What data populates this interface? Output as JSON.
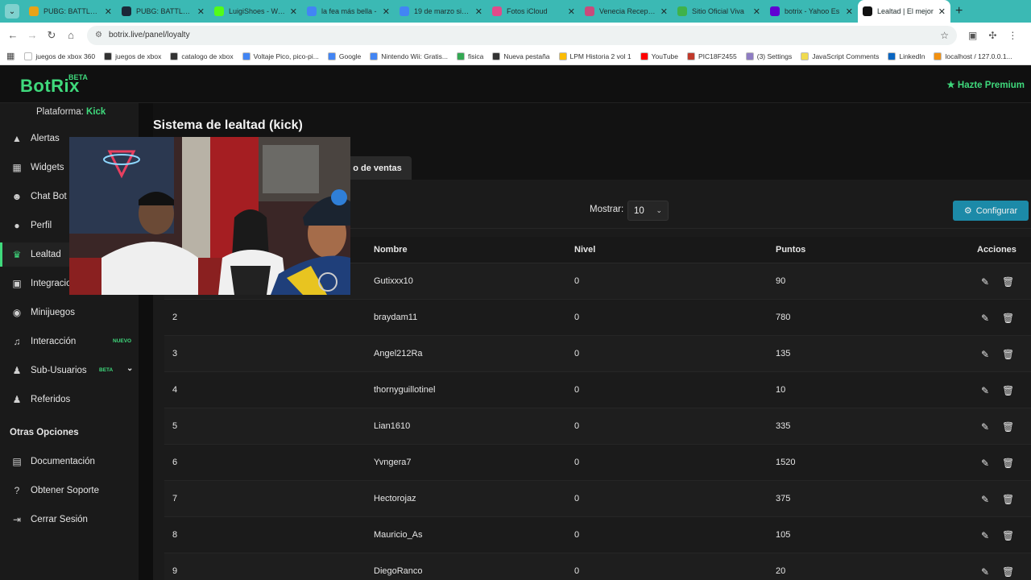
{
  "browser": {
    "tabs": [
      {
        "label": "PUBG: BATTLEGROUNDS",
        "color": "#e8a317"
      },
      {
        "label": "PUBG: BATTLEGROUNDS",
        "color": "#1b2838"
      },
      {
        "label": "LuigiShoes - Watch",
        "color": "#53fc18"
      },
      {
        "label": "la fea más bella -",
        "color": "#4285f4"
      },
      {
        "label": "19 de marzo signo",
        "color": "#4285f4"
      },
      {
        "label": "Fotos iCloud",
        "color": "#e04b8a"
      },
      {
        "label": "Venecia Recepción",
        "color": "#c94b7b"
      },
      {
        "label": "Sitio Oficial Viva",
        "color": "#3fb24a"
      },
      {
        "label": "botrix - Yahoo Es",
        "color": "#6001d2"
      },
      {
        "label": "Lealtad | El mejor",
        "color": "#111111"
      }
    ],
    "active_tab": 9,
    "url": "botrix.live/panel/loyalty",
    "bookmarks": [
      {
        "label": "juegos de xbox 360",
        "color": "#ffffff"
      },
      {
        "label": "juegos de xbox",
        "color": "#333333"
      },
      {
        "label": "catalogo de xbox",
        "color": "#333333"
      },
      {
        "label": "Voltaje Pico, pico-pi...",
        "color": "#4285f4"
      },
      {
        "label": "Google",
        "color": "#4285f4"
      },
      {
        "label": "Nintendo Wii: Gratis...",
        "color": "#4285f4"
      },
      {
        "label": "fisica",
        "color": "#34a853"
      },
      {
        "label": "Nueva pestaña",
        "color": "#333333"
      },
      {
        "label": "LPM Historia 2 vol 1",
        "color": "#fbbc05"
      },
      {
        "label": "YouTube",
        "color": "#ff0000"
      },
      {
        "label": "PIC18F2455",
        "color": "#c0392b"
      },
      {
        "label": "(3) Settings",
        "color": "#8e7cc3"
      },
      {
        "label": "JavaScript Comments",
        "color": "#f0db4f"
      },
      {
        "label": "LinkedIn",
        "color": "#0a66c2"
      },
      {
        "label": "localhost / 127.0.0.1...",
        "color": "#f29111"
      }
    ]
  },
  "header": {
    "logo": "BotRix",
    "logo_badge": "BETA",
    "premium_label": "Hazte Premium"
  },
  "sidebar": {
    "platform_label": "Plataforma:",
    "platform_value": "Kick",
    "items": [
      {
        "label": "Alertas",
        "icon": "warning-icon",
        "glyph": "▲"
      },
      {
        "label": "Widgets",
        "icon": "grid-icon",
        "glyph": "▦"
      },
      {
        "label": "Chat Bot",
        "icon": "robot-icon",
        "glyph": "☻"
      },
      {
        "label": "Perfil",
        "icon": "user-icon",
        "glyph": "●"
      },
      {
        "label": "Lealtad",
        "icon": "trophy-icon",
        "glyph": "♛"
      },
      {
        "label": "Integraciones",
        "icon": "plug-icon",
        "glyph": "▣"
      },
      {
        "label": "Minijuegos",
        "icon": "gamepad-icon",
        "glyph": "◉"
      },
      {
        "label": "Interacción",
        "icon": "music-icon",
        "glyph": "♫"
      },
      {
        "label": "Sub-Usuarios",
        "icon": "users-icon",
        "glyph": "♟"
      },
      {
        "label": "Referidos",
        "icon": "referrals-icon",
        "glyph": "♟"
      }
    ],
    "badge_nuevo": "NUEVO",
    "badge_beta": "BETA",
    "other_title": "Otras Opciones",
    "other_items": [
      {
        "label": "Documentación",
        "icon": "book-icon",
        "glyph": "▤"
      },
      {
        "label": "Obtener Soporte",
        "icon": "help-icon",
        "glyph": "?"
      },
      {
        "label": "Cerrar Sesión",
        "icon": "logout-icon",
        "glyph": "⇥"
      }
    ]
  },
  "main": {
    "title": "Sistema de lealtad (kick)",
    "tab_ventas": "o de ventas",
    "mostrar_label": "Mostrar:",
    "mostrar_value": "10",
    "config_label": "Configurar",
    "columns": {
      "nombre": "Nombre",
      "nivel": "Nivel",
      "puntos": "Puntos",
      "acciones": "Acciones"
    },
    "rows": [
      {
        "rank": "1",
        "name": "Gutixxx10",
        "level": "0",
        "points": "90"
      },
      {
        "rank": "2",
        "name": "braydam11",
        "level": "0",
        "points": "780"
      },
      {
        "rank": "3",
        "name": "Angel212Ra",
        "level": "0",
        "points": "135"
      },
      {
        "rank": "4",
        "name": "thornyguillotinel",
        "level": "0",
        "points": "10"
      },
      {
        "rank": "5",
        "name": "Lian1610",
        "level": "0",
        "points": "335"
      },
      {
        "rank": "6",
        "name": "Yvngera7",
        "level": "0",
        "points": "1520"
      },
      {
        "rank": "7",
        "name": "Hectorojaz",
        "level": "0",
        "points": "375"
      },
      {
        "rank": "8",
        "name": "Mauricio_As",
        "level": "0",
        "points": "105"
      },
      {
        "rank": "9",
        "name": "DiegoRanco",
        "level": "0",
        "points": "20"
      }
    ]
  },
  "colors": {
    "accent": "#3fd97c",
    "config_button": "#1c8aa8",
    "tabbar": "#3bb9b4"
  }
}
